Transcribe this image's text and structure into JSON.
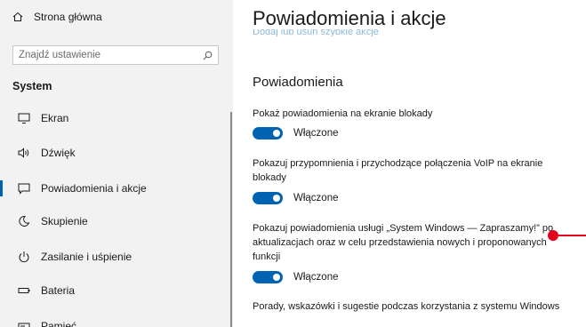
{
  "sidebar": {
    "home_label": "Strona główna",
    "search_placeholder": "Znajdź ustawienie",
    "section_title": "System",
    "items": [
      {
        "label": "Ekran",
        "icon": "monitor-icon"
      },
      {
        "label": "Dźwięk",
        "icon": "speaker-icon"
      },
      {
        "label": "Powiadomienia i akcje",
        "icon": "notifications-icon",
        "active": true
      },
      {
        "label": "Skupienie",
        "icon": "moon-icon"
      },
      {
        "label": "Zasilanie i uśpienie",
        "icon": "power-icon"
      },
      {
        "label": "Bateria",
        "icon": "battery-icon"
      },
      {
        "label": "Pamięć",
        "icon": "storage-icon"
      }
    ]
  },
  "main": {
    "title": "Powiadomienia i akcje",
    "faded_link": "Dodaj lub usuń szybkie akcje",
    "subhead": "Powiadomienia",
    "settings": [
      {
        "text": "Pokaż powiadomienia na ekranie blokady",
        "toggle_label": "Włączone"
      },
      {
        "text": "Pokazuj przypomnienia i przychodzące połączenia VoIP na ekranie blokady",
        "toggle_label": "Włączone"
      },
      {
        "text": "Pokazuj powiadomienia usługi „System Windows — Zapraszamy!” po aktualizacjach oraz w celu przedstawienia nowych i proponowanych funkcji",
        "toggle_label": "Włączone"
      },
      {
        "text": "Porady, wskazówki i sugestie podczas korzystania z systemu Windows"
      }
    ]
  },
  "colors": {
    "accent": "#0063b1",
    "sidebar_bg": "#f2f2f2",
    "callout": "#e3001b"
  }
}
